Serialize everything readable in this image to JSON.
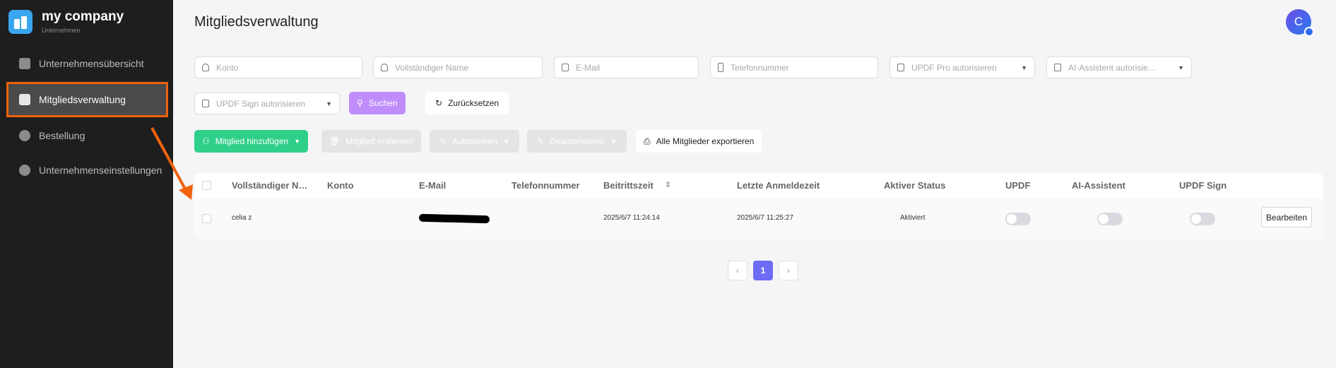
{
  "sidebar": {
    "brand": "my company",
    "brand_sub": "Unternehmen",
    "items": [
      {
        "label": "Unternehmensübersicht",
        "icon": "overview-icon"
      },
      {
        "label": "Mitgliedsverwaltung",
        "icon": "members-icon",
        "active": true
      },
      {
        "label": "Bestellung",
        "icon": "order-icon"
      },
      {
        "label": "Unternehmenseinstellungen",
        "icon": "gear-icon"
      }
    ]
  },
  "header": {
    "title": "Mitgliedsverwaltung",
    "avatar": "C"
  },
  "filters": {
    "konto": "Konto",
    "name": "Vollständiger Name",
    "email": "E-Mail",
    "phone": "Telefonnummer",
    "updf_pro": "UPDF Pro autorisieren",
    "ai": "AI-Assistent autorisie…",
    "sign": "UPDF Sign autorisieren",
    "search": "Suchen",
    "reset": "Zurücksetzen"
  },
  "actions": {
    "add": "Mitglied hinzufügen",
    "remove": "Mitglied entfernen",
    "authorize": "Autorisieren",
    "deauthorize": "Deautorisieren",
    "export": "Alle Mitglieder exportieren"
  },
  "table": {
    "headers": [
      "Vollständiger N…",
      "Konto",
      "E-Mail",
      "Telefonnummer",
      "Beitrittszeit",
      "Letzte Anmeldezeit",
      "Aktiver Status",
      "UPDF",
      "AI-Assistent",
      "UPDF Sign"
    ],
    "rows": [
      {
        "name": "celia z",
        "konto": "",
        "email": "",
        "phone": "",
        "joined": "2025/6/7 11:24:14",
        "last_login": "2025/6/7 11:25:27",
        "status": "Aktiviert",
        "updf": false,
        "ai": false,
        "sign": false,
        "edit": "Bearbeiten"
      }
    ]
  },
  "pagination": {
    "prev": "‹",
    "current": "1",
    "next": "›"
  },
  "colors": {
    "accent": "#6e6cf6",
    "highlight": "#f0620e",
    "green": "#2fcf8a",
    "search": "#c08efb"
  }
}
